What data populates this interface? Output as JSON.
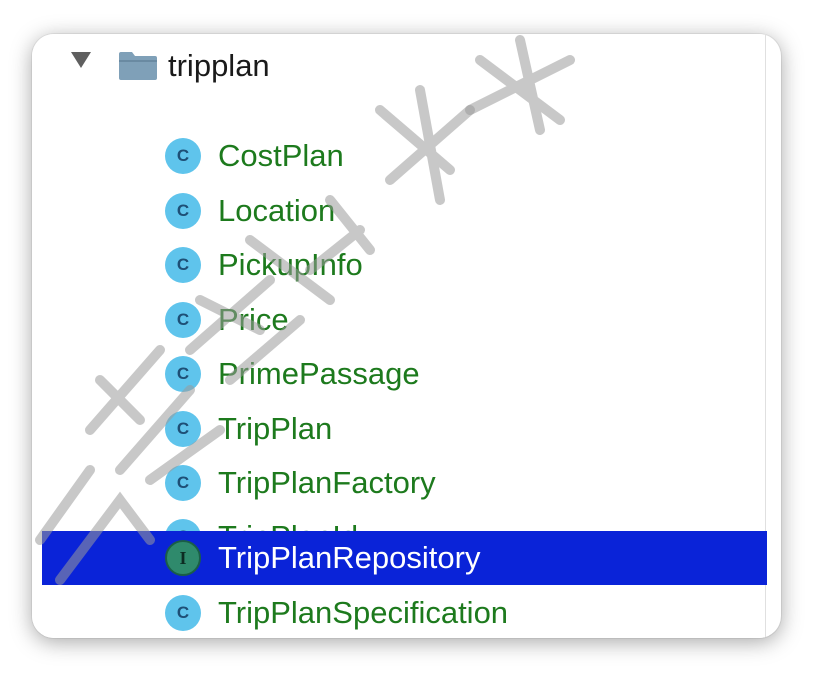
{
  "folder": {
    "name": "tripplan",
    "expanded": true,
    "icon": "folder-icon",
    "chevron": "chevron-down-icon"
  },
  "items": [
    {
      "name": "CostPlan",
      "kind": "class",
      "badge": "C",
      "selected": false
    },
    {
      "name": "Location",
      "kind": "class",
      "badge": "C",
      "selected": false
    },
    {
      "name": "PickupInfo",
      "kind": "class",
      "badge": "C",
      "selected": false
    },
    {
      "name": "Price",
      "kind": "class",
      "badge": "C",
      "selected": false
    },
    {
      "name": "PrimePassage",
      "kind": "class",
      "badge": "C",
      "selected": false
    },
    {
      "name": "TripPlan",
      "kind": "class",
      "badge": "C",
      "selected": false
    },
    {
      "name": "TripPlanFactory",
      "kind": "class",
      "badge": "C",
      "selected": false
    },
    {
      "name": "TripPlanId",
      "kind": "class",
      "badge": "C",
      "selected": false
    },
    {
      "name": "TripPlanRepository",
      "kind": "interface",
      "badge": "I",
      "selected": true
    },
    {
      "name": "TripPlanSpecification",
      "kind": "class",
      "badge": "C",
      "selected": false
    }
  ],
  "colors": {
    "selection": "#0a23d8",
    "class_name": "#1d7a1d",
    "class_badge": "#5fc4ec",
    "interface_badge": "#2f8a6c",
    "folder_icon": "#7fa0b8"
  }
}
